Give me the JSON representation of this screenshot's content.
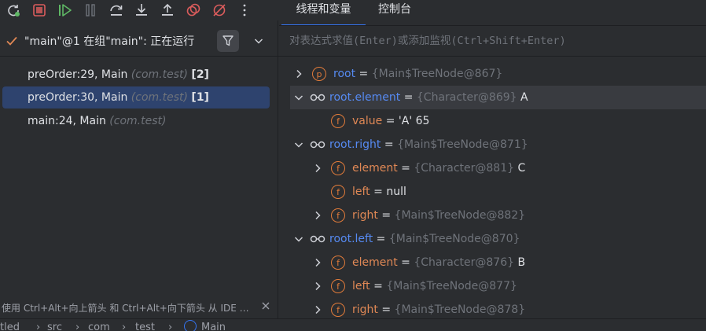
{
  "toolbar": {
    "buttons": [
      {
        "name": "rerun-icon"
      },
      {
        "name": "stop-icon",
        "color": "#db5c5c"
      },
      {
        "name": "resume-icon",
        "color": "#5fb865"
      },
      {
        "name": "pause-icon"
      },
      {
        "name": "step-over-icon"
      },
      {
        "name": "step-into-icon"
      },
      {
        "name": "step-out-icon"
      },
      {
        "name": "view-breakpoints-icon",
        "color": "#db5c5c"
      },
      {
        "name": "mute-breakpoints-icon",
        "color": "#db5c5c"
      },
      {
        "name": "more-options-icon"
      }
    ]
  },
  "tabs": [
    {
      "label": "线程和变量",
      "active": true
    },
    {
      "label": "控制台",
      "active": false
    }
  ],
  "thread": {
    "label": "\"main\"@1 在组\"main\": 正在运行"
  },
  "frames": [
    {
      "method": "preOrder:29, Main",
      "pkg": "(com.test)",
      "count": "[2]",
      "selected": false
    },
    {
      "method": "preOrder:30, Main",
      "pkg": "(com.test)",
      "count": "[1]",
      "selected": true
    },
    {
      "method": "main:24, Main",
      "pkg": "(com.test)",
      "count": "",
      "selected": false
    }
  ],
  "hint": "使用 Ctrl+Alt+向上箭头 和 Ctrl+Alt+向下箭头 从 IDE …",
  "eval": {
    "placeholder": "对表达式求值(Enter)或添加监视(Ctrl+Shift+Enter)"
  },
  "variables": [
    {
      "name": "root",
      "eq": " = ",
      "ref": "{Main$TreeNode@867}",
      "val": "",
      "icon": "p",
      "expand": "collapsed",
      "style": "blue"
    },
    {
      "name": "root.element",
      "eq": " = ",
      "ref": "{Character@869}",
      "val": " A",
      "icon": "watch",
      "expand": "expanded",
      "style": "blue",
      "selected": true
    },
    {
      "name": "value",
      "eq": " = ",
      "ref": "",
      "val": "'A' 65",
      "icon": "f",
      "expand": "none",
      "style": "orange"
    },
    {
      "name": "root.right",
      "eq": " = ",
      "ref": "{Main$TreeNode@871}",
      "val": "",
      "icon": "watch",
      "expand": "expanded",
      "style": "blue"
    },
    {
      "name": "element",
      "eq": " = ",
      "ref": "{Character@881}",
      "val": " C",
      "icon": "f",
      "expand": "collapsed",
      "style": "orange"
    },
    {
      "name": "left",
      "eq": " = ",
      "ref": "",
      "val": "null",
      "icon": "f",
      "expand": "none",
      "style": "orange"
    },
    {
      "name": "right",
      "eq": " = ",
      "ref": "{Main$TreeNode@882}",
      "val": "",
      "icon": "f",
      "expand": "collapsed",
      "style": "orange"
    },
    {
      "name": "root.left",
      "eq": " = ",
      "ref": "{Main$TreeNode@870}",
      "val": "",
      "icon": "watch",
      "expand": "expanded",
      "style": "blue"
    },
    {
      "name": "element",
      "eq": " = ",
      "ref": "{Character@876}",
      "val": " B",
      "icon": "f",
      "expand": "collapsed",
      "style": "orange"
    },
    {
      "name": "left",
      "eq": " = ",
      "ref": "{Main$TreeNode@877}",
      "val": "",
      "icon": "f",
      "expand": "collapsed",
      "style": "orange"
    },
    {
      "name": "right",
      "eq": " = ",
      "ref": "{Main$TreeNode@878}",
      "val": "",
      "icon": "f",
      "expand": "collapsed",
      "style": "orange"
    }
  ],
  "status": {
    "crumbs": [
      "tled",
      "src",
      "com",
      "test",
      "Main"
    ]
  }
}
